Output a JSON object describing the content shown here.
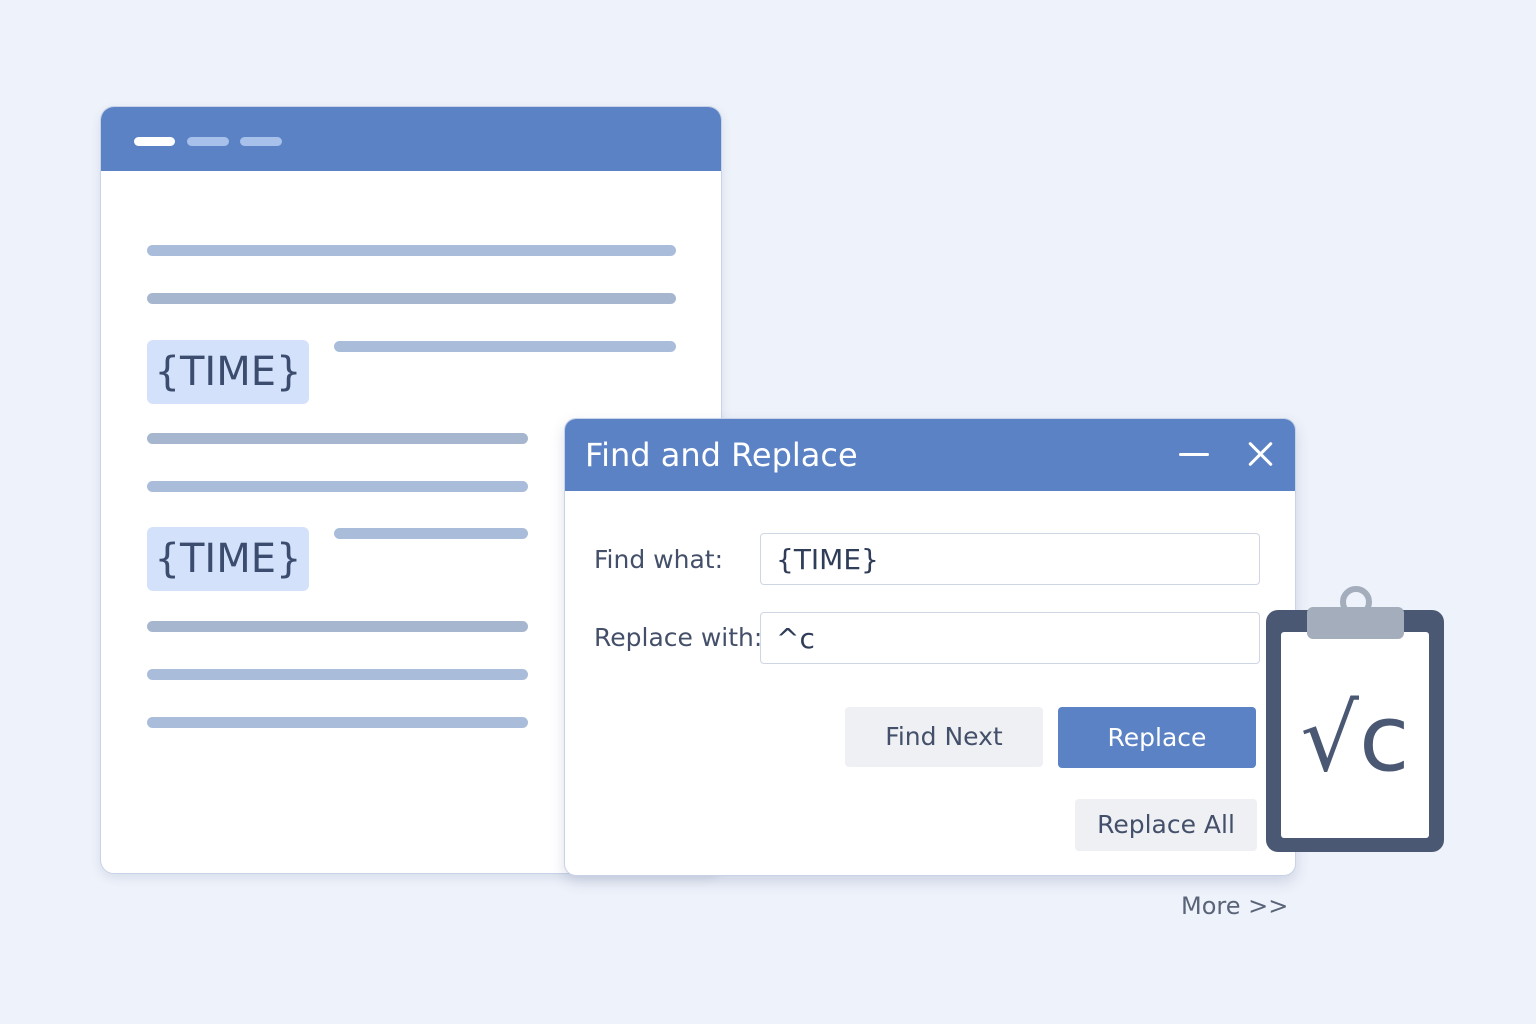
{
  "document": {
    "placeholder_token": "{TIME}"
  },
  "dialog": {
    "title": "Find and Replace",
    "find_label": "Find what:",
    "find_value": "{TIME}",
    "replace_label": "Replace with:",
    "replace_value": "^c",
    "find_next_label": "Find Next",
    "replace_label_btn": "Replace",
    "replace_all_label": "Replace All",
    "more_label": "More >>"
  },
  "clipboard": {
    "icon": "clipboard-icon",
    "content": "√c"
  },
  "colors": {
    "accent": "#5b82c5",
    "background": "#eef2fa",
    "highlight": "#d3e2fa",
    "clipboard_frame": "#4a5873"
  }
}
